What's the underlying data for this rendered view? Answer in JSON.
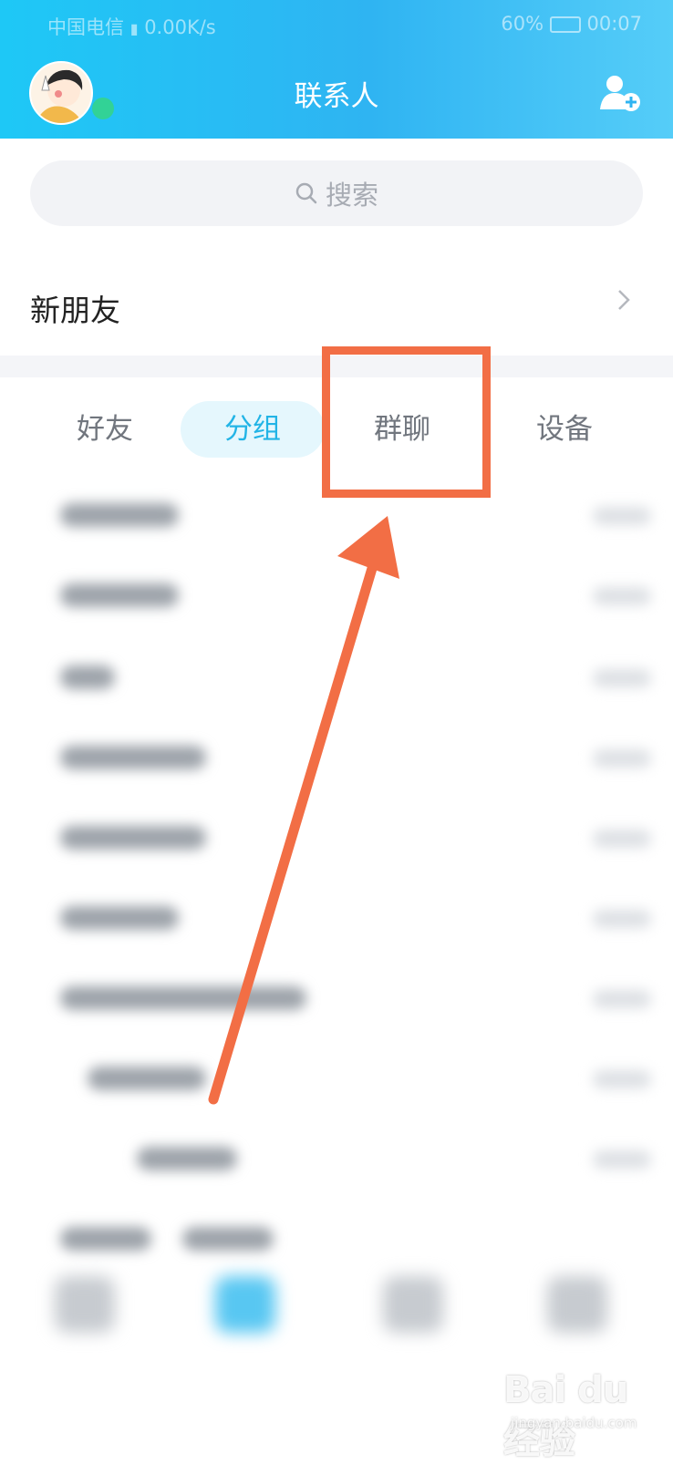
{
  "status_bar": {
    "carrier": "中国电信",
    "network_speed": "0.00K/s",
    "battery": "60%",
    "time": "00:07"
  },
  "header": {
    "title": "联系人"
  },
  "search": {
    "placeholder": "搜索"
  },
  "new_friends": {
    "label": "新朋友"
  },
  "tabs": [
    {
      "label": "好友",
      "active": false
    },
    {
      "label": "分组",
      "active": true
    },
    {
      "label": "群聊",
      "active": false
    },
    {
      "label": "设备",
      "active": false
    }
  ],
  "annotation": {
    "color": "#f26e45",
    "highlighted_tab": "群聊"
  },
  "watermark": {
    "main": "Bai du 经验",
    "sub": "jingyan.baidu.com"
  },
  "colors": {
    "header_start": "#1ec8f6",
    "header_end": "#55cdf8",
    "accent": "#22b4e6",
    "online": "#32d296"
  }
}
